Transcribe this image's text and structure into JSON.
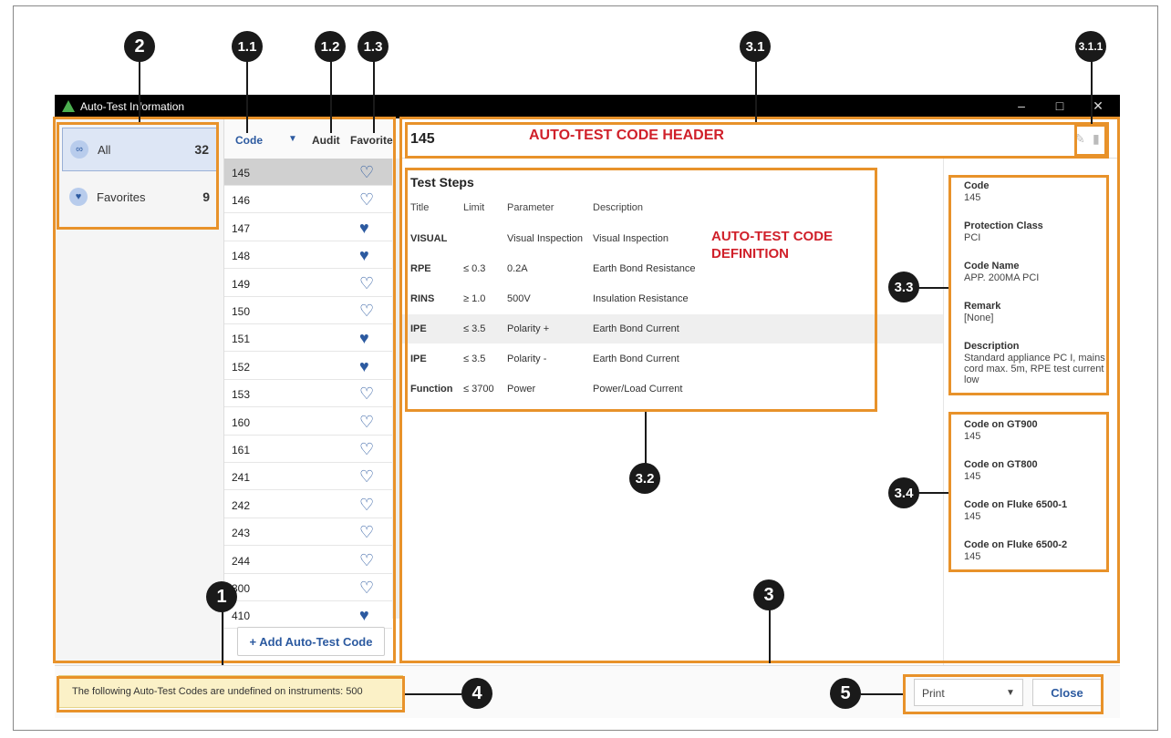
{
  "window": {
    "title": "Auto-Test Information",
    "minimize": "–",
    "maximize": "□",
    "close": "✕"
  },
  "callouts": {
    "c2": "2",
    "c11": "1.1",
    "c12": "1.2",
    "c13": "1.3",
    "c31": "3.1",
    "c311": "3.1.1",
    "c33": "3.3",
    "c32": "3.2",
    "c34": "3.4",
    "c1": "1",
    "c3": "3",
    "c4": "4",
    "c5": "5"
  },
  "filters": [
    {
      "icon": "infinity-icon",
      "glyph": "∞",
      "label": "All",
      "count": "32"
    },
    {
      "icon": "heart-icon",
      "glyph": "♥",
      "label": "Favorites",
      "count": "9"
    }
  ],
  "codelist": {
    "header_code": "Code",
    "sort_glyph": "▼",
    "header_audit": "Audit",
    "header_favorite": "Favorite",
    "rows": [
      {
        "code": "145",
        "fav": "♡"
      },
      {
        "code": "146",
        "fav": "♡"
      },
      {
        "code": "147",
        "fav": "♥"
      },
      {
        "code": "148",
        "fav": "♥"
      },
      {
        "code": "149",
        "fav": "♡"
      },
      {
        "code": "150",
        "fav": "♡"
      },
      {
        "code": "151",
        "fav": "♥"
      },
      {
        "code": "152",
        "fav": "♥"
      },
      {
        "code": "153",
        "fav": "♡"
      },
      {
        "code": "160",
        "fav": "♡"
      },
      {
        "code": "161",
        "fav": "♡"
      },
      {
        "code": "241",
        "fav": "♡"
      },
      {
        "code": "242",
        "fav": "♡"
      },
      {
        "code": "243",
        "fav": "♡"
      },
      {
        "code": "244",
        "fav": "♡"
      },
      {
        "code": "300",
        "fav": "♡"
      },
      {
        "code": "410",
        "fav": "♥"
      }
    ],
    "add_button": "+ Add Auto-Test Code"
  },
  "detail": {
    "code": "145",
    "header_annotation": "AUTO-TEST CODE HEADER",
    "edit_icon": "✎",
    "delete_icon": "▮",
    "steps_title": "Test Steps",
    "columns": {
      "title": "Title",
      "limit": "Limit",
      "parameter": "Parameter",
      "description": "Description"
    },
    "steps": [
      {
        "title": "VISUAL",
        "limit": "",
        "parameter": "Visual Inspection",
        "description": "Visual Inspection"
      },
      {
        "title": "RPE",
        "limit": "≤ 0.3",
        "parameter": "0.2A",
        "description": "Earth Bond Resistance"
      },
      {
        "title": "RINS",
        "limit": "≥ 1.0",
        "parameter": "500V",
        "description": "Insulation Resistance"
      },
      {
        "title": "IPE",
        "limit": "≤ 3.5",
        "parameter": "Polarity +",
        "description": "Earth Bond Current"
      },
      {
        "title": "IPE",
        "limit": "≤ 3.5",
        "parameter": "Polarity -",
        "description": "Earth Bond Current"
      },
      {
        "title": "Function",
        "limit": "≤ 3700",
        "parameter": "Power",
        "description": "Power/Load Current"
      }
    ],
    "definition_annotation_1": "AUTO-TEST CODE",
    "definition_annotation_2": "DEFINITION"
  },
  "properties": {
    "code_label": "Code",
    "code_value": "145",
    "protection_label": "Protection Class",
    "protection_value": "PCI",
    "name_label": "Code Name",
    "name_value": "APP. 200MA PCI",
    "remark_label": "Remark",
    "remark_value": "[None]",
    "description_label": "Description",
    "description_value": "Standard appliance PC I, mains cord max. 5m, RPE test current low"
  },
  "instruments": [
    {
      "label": "Code on GT900",
      "value": "145"
    },
    {
      "label": "Code on GT800",
      "value": "145"
    },
    {
      "label": "Code on Fluke 6500-1",
      "value": "145"
    },
    {
      "label": "Code on Fluke 6500-2",
      "value": "145"
    }
  ],
  "bottom": {
    "warning": "The following Auto-Test Codes are undefined on instruments: 500",
    "print_value": "Print",
    "print_arrow": "▼",
    "close_label": "Close"
  },
  "colors": {
    "accent": "#2c5aa0",
    "annotation_red": "#d0202a",
    "callout_box": "#e8922a"
  }
}
